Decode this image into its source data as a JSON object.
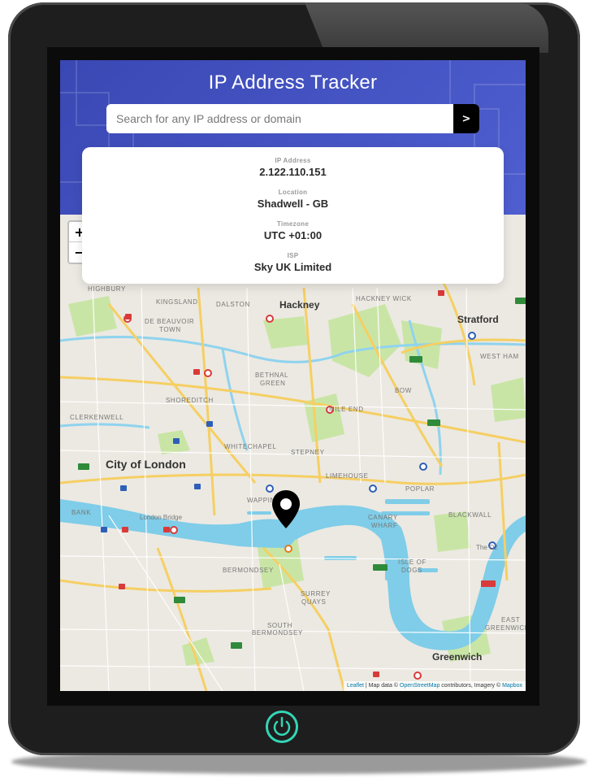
{
  "app": {
    "title": "IP Address Tracker"
  },
  "search": {
    "placeholder": "Search for any IP address or domain",
    "value": "",
    "button_label": ">"
  },
  "info": {
    "ip_label": "IP Address",
    "ip_value": "2.122.110.151",
    "location_label": "Location",
    "location_value": "Shadwell - GB",
    "timezone_label": "Timezone",
    "timezone_value": "UTC +01:00",
    "isp_label": "ISP",
    "isp_value": "Sky UK Limited"
  },
  "map": {
    "zoom_in_label": "+",
    "zoom_out_label": "−",
    "labels": {
      "hackney": "Hackney",
      "stratford": "Stratford",
      "city_of_london": "City of London",
      "greenwich": "Greenwich",
      "highbury": "HIGHBURY",
      "kingsland": "KINGSLAND",
      "dalston": "DALSTON",
      "hackney_wick": "HACKNEY WICK",
      "de_beauvoir": "DE BEAUVOIR",
      "town": "TOWN",
      "west_ham": "WEST HAM",
      "bethnal": "BETHNAL",
      "green": "GREEN",
      "bow": "BOW",
      "shoreditch": "SHOREDITCH",
      "mile_end": "MILE END",
      "clerkenwell": "CLERKENWELL",
      "whitechapel": "WHITECHAPEL",
      "stepney": "STEPNEY",
      "limehouse": "LIMEHOUSE",
      "poplar": "POPLAR",
      "wapping": "WAPPING",
      "canary": "CANARY",
      "wharf": "WHARF",
      "blackwall": "BLACKWALL",
      "bank": "BANK",
      "london_bridge": "London Bridge",
      "bermondsey": "BERMONDSEY",
      "surrey": "SURREY",
      "quays": "QUAYS",
      "isle_of": "ISLE OF",
      "dogs": "DOGS",
      "south": "SOUTH",
      "south_bermondsey": "BERMONDSEY",
      "east": "EAST",
      "greenwich_small": "GREENWICH",
      "the_o2": "The O2"
    },
    "attribution_leaflet": "Leaflet",
    "attribution_text": " | Map data © ",
    "attribution_osm": "OpenStreetMap",
    "attribution_contrib": " contributors, Imagery © ",
    "attribution_mapbox": "Mapbox"
  },
  "colors": {
    "header": "#4a57c4",
    "water": "#7fcde8",
    "park": "#c8e6a5",
    "road": "#f7d36b",
    "accent_power": "#33d6b5"
  }
}
